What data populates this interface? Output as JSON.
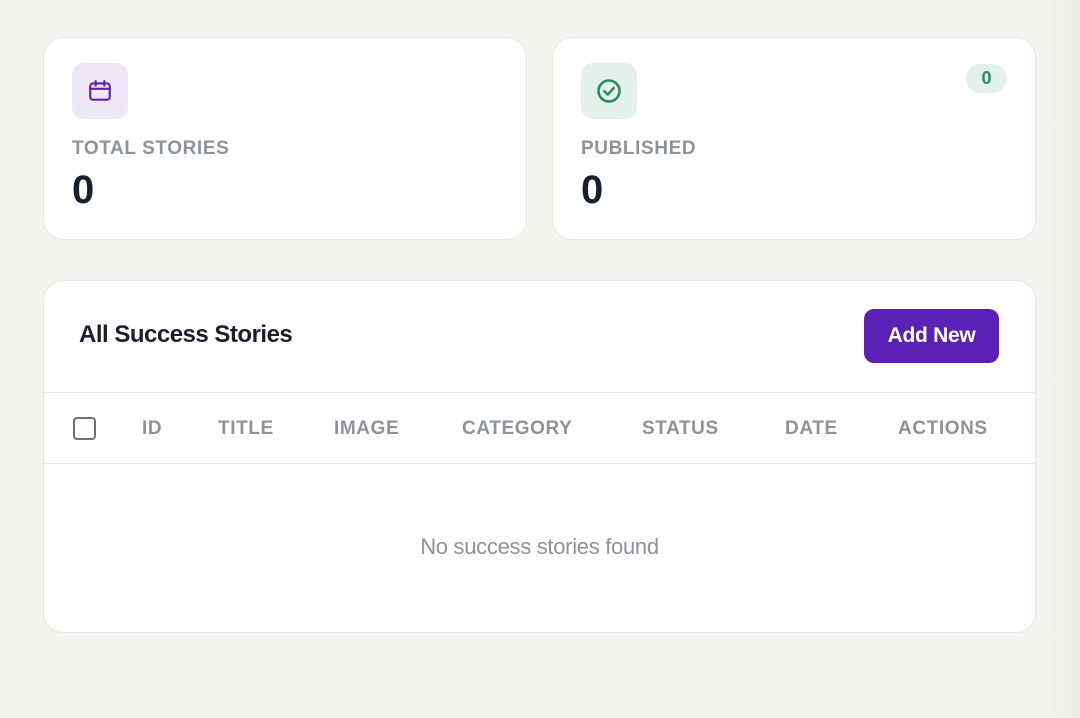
{
  "stats": {
    "total": {
      "label": "TOTAL STORIES",
      "value": "0",
      "icon": "calendar-icon",
      "icon_color": "#5b21b6",
      "icon_bg": "#ede7f6"
    },
    "published": {
      "label": "PUBLISHED",
      "value": "0",
      "badge": "0",
      "icon": "check-circle-icon",
      "icon_color": "#2a8b63",
      "icon_bg": "#e3f1ea"
    }
  },
  "table": {
    "title": "All Success Stories",
    "add_button_label": "Add New",
    "columns": {
      "id": "ID",
      "title": "TITLE",
      "image": "IMAGE",
      "category": "CATEGORY",
      "status": "STATUS",
      "date": "DATE",
      "actions": "ACTIONS"
    },
    "empty_message": "No success stories found"
  },
  "colors": {
    "accent": "#5b21b6",
    "success": "#2a8b63",
    "background": "#f5f4f0"
  }
}
